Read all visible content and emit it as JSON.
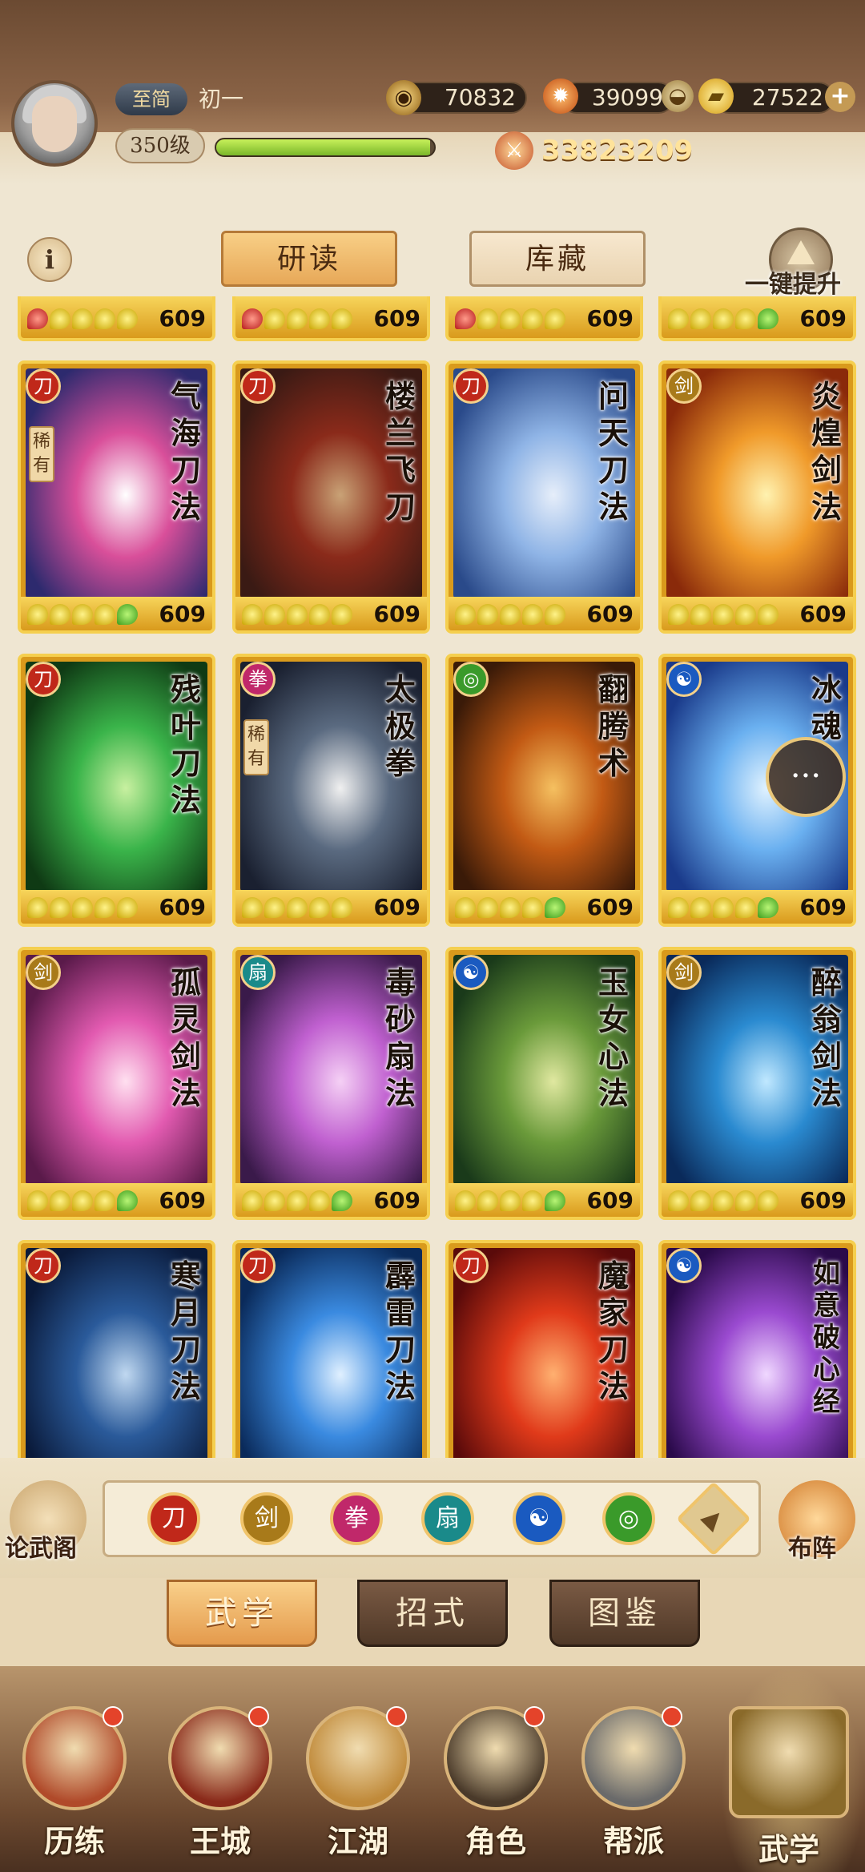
{
  "player": {
    "vip": "至简",
    "name": "初一",
    "level": "350级",
    "xp_fraction": 0.98,
    "power": "33823209"
  },
  "resources": {
    "coins": "70832",
    "gold_leaf": "39099",
    "ingots": "27522"
  },
  "tabs": {
    "study": "研读",
    "collection": "库藏"
  },
  "one_key_upgrade": "一键提升",
  "partial_row_count": "609",
  "cards": [
    {
      "name": "气海刀法",
      "school": "saber",
      "rare": true,
      "rarity_label": "稀有",
      "count": "609",
      "beads": "yyyyg",
      "art": [
        "#2d2a6e",
        "#d94f9a",
        "#ffffff"
      ]
    },
    {
      "name": "楼兰飞刀",
      "school": "saber",
      "rare": false,
      "count": "609",
      "beads": "yyyyy",
      "art": [
        "#3a1a14",
        "#8a2a1a",
        "#c9a276"
      ]
    },
    {
      "name": "问天刀法",
      "school": "saber",
      "rare": false,
      "count": "609",
      "beads": "yyyyy",
      "art": [
        "#2a4a8a",
        "#8fb4e6",
        "#e6eefa"
      ]
    },
    {
      "name": "炎煌剑法",
      "school": "sword",
      "rare": false,
      "count": "609",
      "beads": "yyyyy",
      "art": [
        "#8a2a0a",
        "#f09a2a",
        "#fff2b0"
      ]
    },
    {
      "name": "残叶刀法",
      "school": "saber",
      "rare": false,
      "count": "609",
      "beads": "yyyyy",
      "art": [
        "#0f3a14",
        "#3ab44a",
        "#c8f0a0"
      ]
    },
    {
      "name": "太极拳",
      "school": "fist",
      "rare": true,
      "rarity_label": "稀有",
      "count": "609",
      "beads": "yyyyy",
      "art": [
        "#1a2030",
        "#5a6a80",
        "#f0f0f0"
      ]
    },
    {
      "name": "翻腾术",
      "school": "flex",
      "rare": false,
      "count": "609",
      "beads": "yyyyg",
      "art": [
        "#3a1a08",
        "#c25a14",
        "#f5c060"
      ]
    },
    {
      "name": "冰魂",
      "school": "inner",
      "rare": false,
      "count": "609",
      "beads": "yyyyg",
      "art": [
        "#1a3a8a",
        "#6ab0f0",
        "#e0f2ff"
      ]
    },
    {
      "name": "孤灵剑法",
      "school": "sword",
      "rare": false,
      "count": "609",
      "beads": "yyyyg",
      "art": [
        "#5a1a4a",
        "#e25ab0",
        "#ffe0f0"
      ]
    },
    {
      "name": "毒砂扇法",
      "school": "fan",
      "rare": false,
      "count": "609",
      "beads": "yyyyg",
      "art": [
        "#3a1a4a",
        "#c060d0",
        "#f5d0f5"
      ]
    },
    {
      "name": "玉女心法",
      "school": "inner",
      "rare": false,
      "count": "609",
      "beads": "yyyyg",
      "art": [
        "#1a3a1a",
        "#6a9a3a",
        "#e0e8a0"
      ]
    },
    {
      "name": "醉翁剑法",
      "school": "sword",
      "rare": false,
      "count": "609",
      "beads": "yyyyy",
      "art": [
        "#0a2a5a",
        "#2a8ad0",
        "#c0e8ff"
      ]
    },
    {
      "name": "寒月刀法",
      "school": "saber",
      "rare": false,
      "count": "",
      "beads": "",
      "art": [
        "#0a1a3a",
        "#2a5a9a",
        "#c0d8f0"
      ]
    },
    {
      "name": "霹雷刀法",
      "school": "saber",
      "rare": false,
      "count": "",
      "beads": "",
      "art": [
        "#0a2a5a",
        "#3a8ae0",
        "#e0f0ff"
      ]
    },
    {
      "name": "魔家刀法",
      "school": "saber",
      "rare": false,
      "count": "",
      "beads": "",
      "art": [
        "#5a0a0a",
        "#e03a1a",
        "#ffb070"
      ]
    },
    {
      "name": "如意破心经",
      "school": "inner",
      "rare": false,
      "count": "",
      "beads": "",
      "art": [
        "#2a0a4a",
        "#9a4ad0",
        "#f0d8ff"
      ]
    }
  ],
  "side_buttons": {
    "left": "论武阁",
    "right": "布阵"
  },
  "school_filters": [
    {
      "name": "saber",
      "glyph": "刀",
      "color": "#c0281a"
    },
    {
      "name": "sword",
      "glyph": "剑",
      "color": "#a87a1a"
    },
    {
      "name": "fist",
      "glyph": "拳",
      "color": "#c0286a"
    },
    {
      "name": "fan",
      "glyph": "扇",
      "color": "#1a8a8a"
    },
    {
      "name": "inner",
      "glyph": "☯",
      "color": "#1a5ac0"
    },
    {
      "name": "flex",
      "glyph": "◎",
      "color": "#3a9a2a"
    },
    {
      "name": "special",
      "glyph": "▲",
      "color": "#e0c890"
    }
  ],
  "subtabs": {
    "martial_arts": "武学",
    "moves": "招式",
    "atlas": "图鉴"
  },
  "bottom_nav": [
    {
      "label": "历练",
      "badge": true,
      "color": "#b04a2a"
    },
    {
      "label": "王城",
      "badge": true,
      "color": "#8a2a1a"
    },
    {
      "label": "江湖",
      "badge": true,
      "color": "#c08a3a"
    },
    {
      "label": "角色",
      "badge": true,
      "color": "#4a3a2a"
    },
    {
      "label": "帮派",
      "badge": true,
      "color": "#6a6a6a"
    },
    {
      "label": "武学",
      "badge": false,
      "color": "#8a6a2a"
    }
  ],
  "colors": {
    "accent": "#e7a858",
    "frame_gold": "#f5cf4f",
    "badge_red": "#e4432a"
  }
}
